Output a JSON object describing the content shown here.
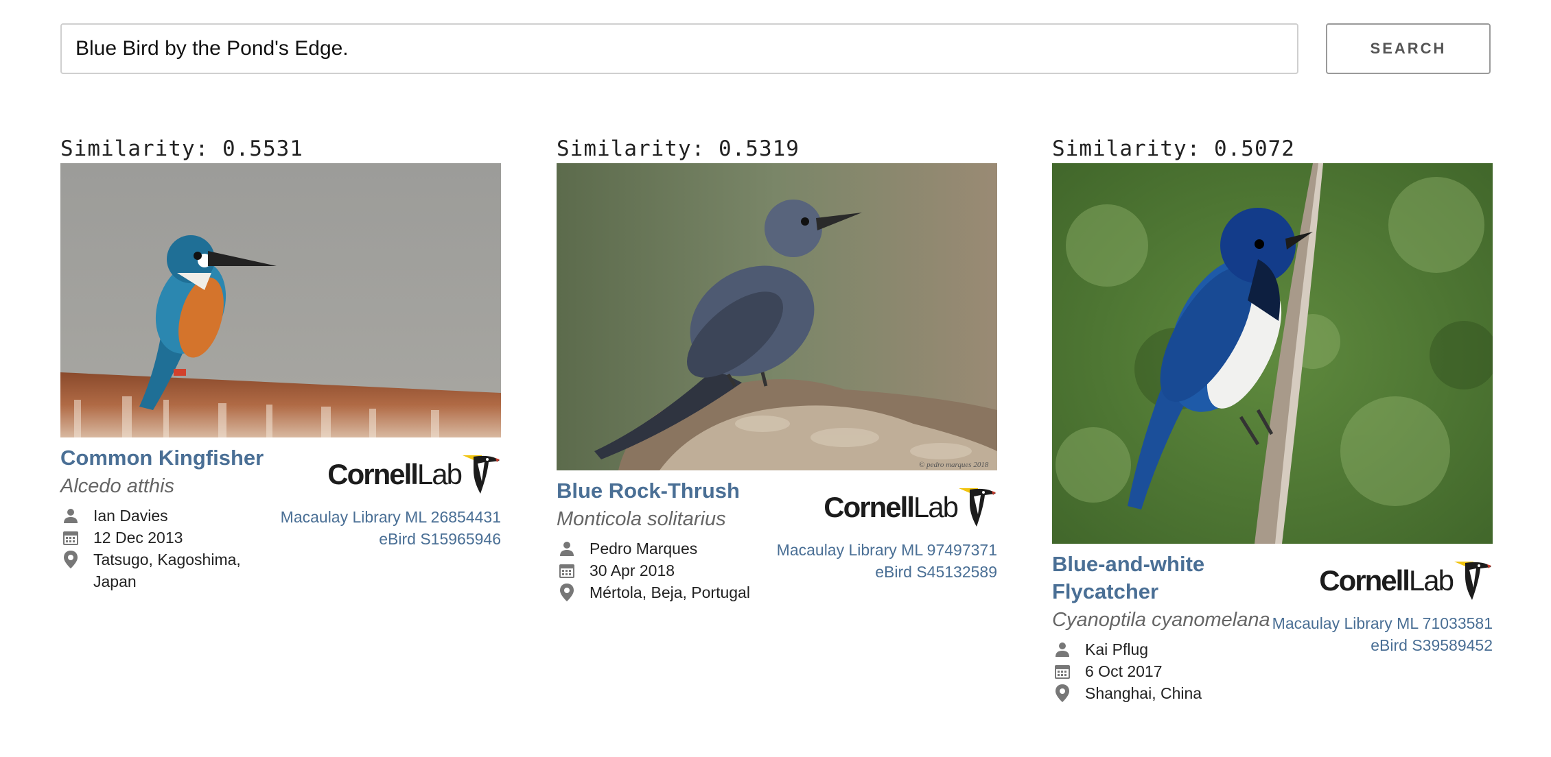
{
  "search": {
    "value": "Blue Bird by the Pond's Edge.",
    "button_label": "SEARCH"
  },
  "results": [
    {
      "similarity": "Similarity: 0.5531",
      "common_name": "Common Kingfisher",
      "scientific_name": "Alcedo atthis",
      "photographer": "Ian Davies",
      "date": "12 Dec 2013",
      "location": "Tatsugo, Kagoshima, Japan",
      "logo": "CornellLab",
      "macaulay": "Macaulay Library ML 26854431",
      "ebird": "eBird S15965946"
    },
    {
      "similarity": "Similarity: 0.5319",
      "common_name": "Blue Rock-Thrush",
      "scientific_name": "Monticola solitarius",
      "photographer": "Pedro Marques",
      "date": "30 Apr 2018",
      "location": "Mértola, Beja, Portugal",
      "logo": "CornellLab",
      "macaulay": "Macaulay Library ML 97497371",
      "ebird": "eBird S45132589",
      "watermark": "© pedro marques 2018"
    },
    {
      "similarity": "Similarity: 0.5072",
      "common_name": "Blue-and-white Flycatcher",
      "scientific_name": "Cyanoptila cyanomelana",
      "photographer": "Kai Pflug",
      "date": "6 Oct 2017",
      "location": "Shanghai, China",
      "logo": "CornellLab",
      "macaulay": "Macaulay Library ML 71033581",
      "ebird": "eBird S39589452"
    }
  ],
  "colors": {
    "link": "#4a6f95",
    "meta_icon": "#777777"
  },
  "icons": [
    "person-icon",
    "calendar-icon",
    "location-pin-icon"
  ]
}
